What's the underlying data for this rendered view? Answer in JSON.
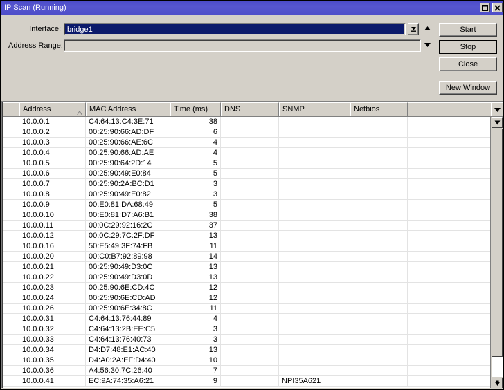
{
  "window": {
    "title": "IP Scan (Running)",
    "controls": {
      "maximize": "maximize-icon",
      "close": "close-icon"
    }
  },
  "form": {
    "interface": {
      "label": "Interface:",
      "value": "bridge1",
      "dropdown_icon": "dropdown-arrow-icon"
    },
    "address_range": {
      "label": "Address Range:",
      "value": "",
      "placeholder": "",
      "dropdown_icon": "chevron-down-icon"
    },
    "spinner": {
      "up_icon": "triangle-up-icon",
      "down_icon": "triangle-down-icon"
    }
  },
  "buttons": {
    "start": "Start",
    "stop": "Stop",
    "close": "Close",
    "new_window": "New Window"
  },
  "table": {
    "columns": [
      {
        "key": "flag",
        "label": ""
      },
      {
        "key": "addr",
        "label": "Address"
      },
      {
        "key": "mac",
        "label": "MAC Address"
      },
      {
        "key": "time",
        "label": "Time (ms)"
      },
      {
        "key": "dns",
        "label": "DNS"
      },
      {
        "key": "snmp",
        "label": "SNMP"
      },
      {
        "key": "netbios",
        "label": "Netbios"
      },
      {
        "key": "rest",
        "label": ""
      }
    ],
    "sort": {
      "column": "Address",
      "direction": "asc",
      "icon": "sort-asc-icon"
    },
    "dropdown_icon": "column-menu-icon",
    "rows": [
      {
        "flag": "",
        "addr": "10.0.0.1",
        "mac": "C4:64:13:C4:3E:71",
        "time": "38",
        "dns": "",
        "snmp": "",
        "netbios": "",
        "rest": ""
      },
      {
        "flag": "",
        "addr": "10.0.0.2",
        "mac": "00:25:90:66:AD:DF",
        "time": "6",
        "dns": "",
        "snmp": "",
        "netbios": "",
        "rest": ""
      },
      {
        "flag": "",
        "addr": "10.0.0.3",
        "mac": "00:25:90:66:AE:6C",
        "time": "4",
        "dns": "",
        "snmp": "",
        "netbios": "",
        "rest": ""
      },
      {
        "flag": "",
        "addr": "10.0.0.4",
        "mac": "00:25:90:66:AD:AE",
        "time": "4",
        "dns": "",
        "snmp": "",
        "netbios": "",
        "rest": ""
      },
      {
        "flag": "",
        "addr": "10.0.0.5",
        "mac": "00:25:90:64:2D:14",
        "time": "5",
        "dns": "",
        "snmp": "",
        "netbios": "",
        "rest": ""
      },
      {
        "flag": "",
        "addr": "10.0.0.6",
        "mac": "00:25:90:49:E0:84",
        "time": "5",
        "dns": "",
        "snmp": "",
        "netbios": "",
        "rest": ""
      },
      {
        "flag": "",
        "addr": "10.0.0.7",
        "mac": "00:25:90:2A:BC:D1",
        "time": "3",
        "dns": "",
        "snmp": "",
        "netbios": "",
        "rest": ""
      },
      {
        "flag": "",
        "addr": "10.0.0.8",
        "mac": "00:25:90:49:E0:82",
        "time": "3",
        "dns": "",
        "snmp": "",
        "netbios": "",
        "rest": ""
      },
      {
        "flag": "",
        "addr": "10.0.0.9",
        "mac": "00:E0:81:DA:68:49",
        "time": "5",
        "dns": "",
        "snmp": "",
        "netbios": "",
        "rest": ""
      },
      {
        "flag": "",
        "addr": "10.0.0.10",
        "mac": "00:E0:81:D7:A6:B1",
        "time": "38",
        "dns": "",
        "snmp": "",
        "netbios": "",
        "rest": ""
      },
      {
        "flag": "",
        "addr": "10.0.0.11",
        "mac": "00:0C:29:92:16:2C",
        "time": "37",
        "dns": "",
        "snmp": "",
        "netbios": "",
        "rest": ""
      },
      {
        "flag": "",
        "addr": "10.0.0.12",
        "mac": "00:0C:29:7C:2F:DF",
        "time": "13",
        "dns": "",
        "snmp": "",
        "netbios": "",
        "rest": ""
      },
      {
        "flag": "",
        "addr": "10.0.0.16",
        "mac": "50:E5:49:3F:74:FB",
        "time": "11",
        "dns": "",
        "snmp": "",
        "netbios": "",
        "rest": ""
      },
      {
        "flag": "",
        "addr": "10.0.0.20",
        "mac": "00:C0:B7:92:89:98",
        "time": "14",
        "dns": "",
        "snmp": "",
        "netbios": "",
        "rest": ""
      },
      {
        "flag": "",
        "addr": "10.0.0.21",
        "mac": "00:25:90:49:D3:0C",
        "time": "13",
        "dns": "",
        "snmp": "",
        "netbios": "",
        "rest": ""
      },
      {
        "flag": "",
        "addr": "10.0.0.22",
        "mac": "00:25:90:49:D3:0D",
        "time": "13",
        "dns": "",
        "snmp": "",
        "netbios": "",
        "rest": ""
      },
      {
        "flag": "",
        "addr": "10.0.0.23",
        "mac": "00:25:90:6E:CD:4C",
        "time": "12",
        "dns": "",
        "snmp": "",
        "netbios": "",
        "rest": ""
      },
      {
        "flag": "",
        "addr": "10.0.0.24",
        "mac": "00:25:90:6E:CD:AD",
        "time": "12",
        "dns": "",
        "snmp": "",
        "netbios": "",
        "rest": ""
      },
      {
        "flag": "",
        "addr": "10.0.0.26",
        "mac": "00:25:90:6E:34:8C",
        "time": "11",
        "dns": "",
        "snmp": "",
        "netbios": "",
        "rest": ""
      },
      {
        "flag": "",
        "addr": "10.0.0.31",
        "mac": "C4:64:13:76:44:89",
        "time": "4",
        "dns": "",
        "snmp": "",
        "netbios": "",
        "rest": ""
      },
      {
        "flag": "",
        "addr": "10.0.0.32",
        "mac": "C4:64:13:2B:EE:C5",
        "time": "3",
        "dns": "",
        "snmp": "",
        "netbios": "",
        "rest": ""
      },
      {
        "flag": "",
        "addr": "10.0.0.33",
        "mac": "C4:64:13:76:40:73",
        "time": "3",
        "dns": "",
        "snmp": "",
        "netbios": "",
        "rest": ""
      },
      {
        "flag": "",
        "addr": "10.0.0.34",
        "mac": "D4:D7:48:E1:AC:40",
        "time": "13",
        "dns": "",
        "snmp": "",
        "netbios": "",
        "rest": ""
      },
      {
        "flag": "",
        "addr": "10.0.0.35",
        "mac": "D4:A0:2A:EF:D4:40",
        "time": "10",
        "dns": "",
        "snmp": "",
        "netbios": "",
        "rest": ""
      },
      {
        "flag": "",
        "addr": "10.0.0.36",
        "mac": "A4:56:30:7C:26:40",
        "time": "7",
        "dns": "",
        "snmp": "",
        "netbios": "",
        "rest": ""
      },
      {
        "flag": "",
        "addr": "10.0.0.41",
        "mac": "EC:9A:74:35:A6:21",
        "time": "9",
        "dns": "",
        "snmp": "NPI35A621",
        "netbios": "",
        "rest": ""
      }
    ]
  },
  "scrollbar": {
    "up_icon": "scroll-down-icon",
    "down_icon": "scroll-down-icon"
  },
  "colors": {
    "titlebar": "#4e4ec9",
    "face": "#d4d0c8",
    "field_selected_bg": "#0c1a6b",
    "grid_line": "#e3e3e3"
  }
}
